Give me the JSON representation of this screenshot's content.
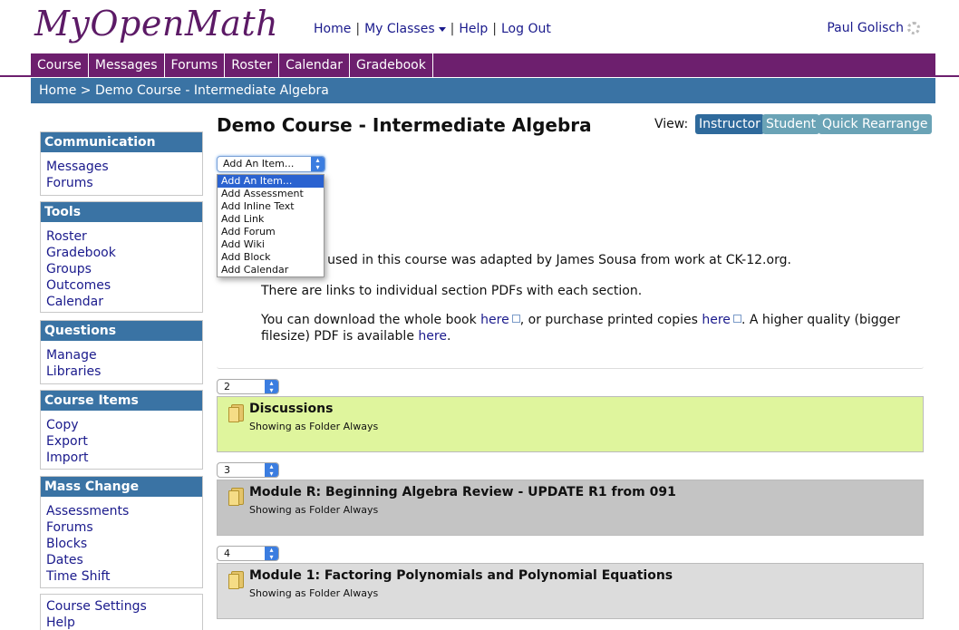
{
  "header": {
    "logo": "MyOpenMath",
    "nav": {
      "home": "Home",
      "my_classes": "My Classes",
      "help": "Help",
      "logout": "Log Out",
      "sep": "|"
    },
    "user": "Paul Golisch"
  },
  "tabs": [
    "Course",
    "Messages",
    "Forums",
    "Roster",
    "Calendar",
    "Gradebook"
  ],
  "breadcrumb": {
    "home": "Home",
    "sep": ">",
    "current": "Demo Course - Intermediate Algebra"
  },
  "sidebar": [
    {
      "heading": "Communication",
      "items": [
        "Messages",
        "Forums"
      ]
    },
    {
      "heading": "Tools",
      "items": [
        "Roster",
        "Gradebook",
        "Groups",
        "Outcomes",
        "Calendar"
      ]
    },
    {
      "heading": "Questions",
      "items": [
        "Manage",
        "Libraries"
      ]
    },
    {
      "heading": "Course Items",
      "items": [
        "Copy",
        "Export",
        "Import"
      ]
    },
    {
      "heading": "Mass Change",
      "items": [
        "Assessments",
        "Forums",
        "Blocks",
        "Dates",
        "Time Shift"
      ]
    },
    {
      "heading": "",
      "items": [
        "Course Settings",
        "Help"
      ]
    }
  ],
  "main": {
    "title": "Demo Course - Intermediate Algebra",
    "view_label": "View:",
    "view_buttons": [
      "Instructor",
      "Student",
      "Quick Rearrange"
    ],
    "add_item": {
      "selected": "Add An Item...",
      "options": [
        "Add An Item...",
        "Add Assessment",
        "Add Inline Text",
        "Add Link",
        "Add Forum",
        "Add Wiki",
        "Add Block",
        "Add Calendar"
      ]
    },
    "text": {
      "line1": "ok used in this course was adapted by James Sousa from work at CK-12.org.",
      "line2": "There are links to individual section PDFs with each section.",
      "line3a": "You can download the whole book ",
      "here1": "here",
      "line3b": ", or purchase printed copies ",
      "here2": "here",
      "line3c": ".  A higher quality (bigger",
      "line4a": "filesize) PDF is available ",
      "here3": "here",
      "line4b": "."
    },
    "blocks": [
      {
        "order": "2",
        "title": "Discussions",
        "subtitle": "Showing as Folder Always",
        "color": "#dff59d"
      },
      {
        "order": "3",
        "title": "Module R: Beginning Algebra Review - UPDATE R1 from 091",
        "subtitle": "Showing as Folder Always",
        "color": "#c4c4c4"
      },
      {
        "order": "4",
        "title": "Module 1: Factoring Polynomials and Polynomial Equations",
        "subtitle": "Showing as Folder Always",
        "color": "#dcdcdc"
      }
    ]
  },
  "colors": {
    "purple": "#6d1f6e",
    "blue": "#3a73a4",
    "link": "#1a1a8c"
  }
}
